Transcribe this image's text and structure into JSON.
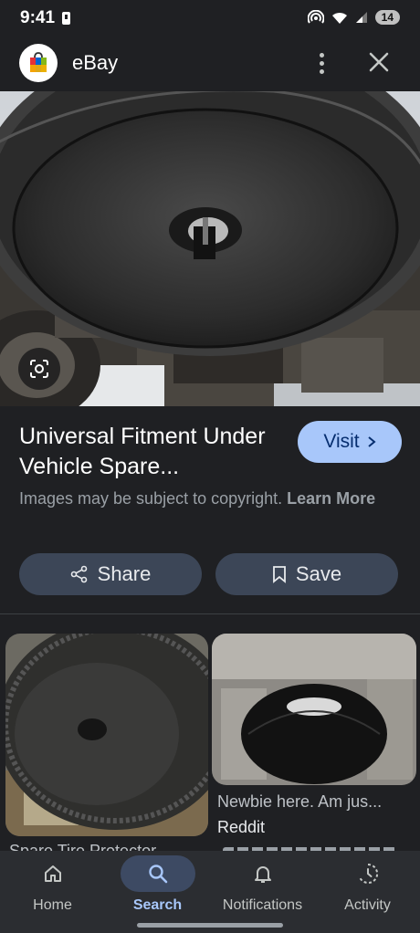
{
  "status_bar": {
    "time": "9:41",
    "battery": "14"
  },
  "header": {
    "title": "eBay",
    "logo_icon": "ebay-shopping-bag-icon"
  },
  "result": {
    "title": "Universal Fitment Under Vehicle Spare...",
    "visit_label": "Visit",
    "copyright_text": "Images may be subject to copyright.",
    "learn_more": "Learn More",
    "share_label": "Share",
    "save_label": "Save"
  },
  "related": [
    {
      "caption": "Spare Tire Protector"
    },
    {
      "caption": "Newbie here. Am jus...",
      "source": "Reddit"
    }
  ],
  "nav": {
    "items": [
      {
        "label": "Home",
        "icon": "home-icon"
      },
      {
        "label": "Search",
        "icon": "search-icon",
        "active": true
      },
      {
        "label": "Notifications",
        "icon": "bell-icon"
      },
      {
        "label": "Activity",
        "icon": "activity-icon"
      }
    ]
  },
  "colors": {
    "background": "#1f2023",
    "accent": "#a8c7fa",
    "button": "#3c4657",
    "nav_background": "#2b2d31"
  }
}
